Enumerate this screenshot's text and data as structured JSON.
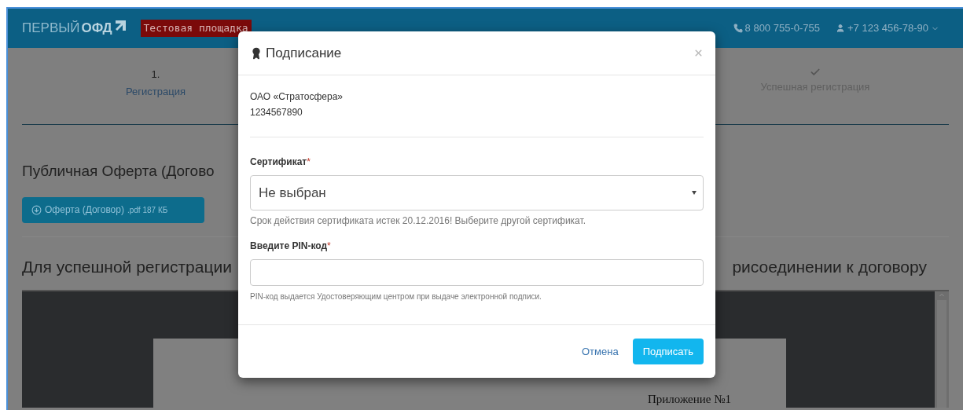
{
  "header": {
    "logo": {
      "light": "ПЕРВЫЙ",
      "bold": "ОФД"
    },
    "badge": "Тестовая площадка",
    "phone": "8 800 755-0-755",
    "user": "+7 123 456-78-90"
  },
  "steps": [
    {
      "kind": "numbered",
      "number": "1.",
      "label": "Регистрация",
      "selected": true
    },
    {
      "kind": "check",
      "label": "Успешная регистрация",
      "selected": false
    }
  ],
  "offer": {
    "heading": "Публичная Оферта (Догово",
    "button": {
      "label": "Оферта (Договор)",
      "meta": ".pdf 187 КБ"
    }
  },
  "registration": {
    "heading_left": "Для успешной регистрации",
    "heading_right": "рисоединении к договору"
  },
  "document": {
    "page_text": "Приложение №1"
  },
  "modal": {
    "title": "Подписание",
    "organization": {
      "name": "ОАО «Стратосфера»",
      "inn": "1234567890"
    },
    "fields": [
      {
        "kind": "select",
        "label": "Сертификат",
        "required": true,
        "required_mark": "*",
        "value": "Не выбран",
        "help": "Срок действия сертификата истек 20.12.2016! Выберите другой сертификат."
      },
      {
        "kind": "input",
        "label": "Введите PIN-код",
        "required": true,
        "required_mark": "*",
        "help": "PIN-код выдается Удостоверяющим центром при выдаче электронной подписи."
      }
    ],
    "cancel": "Отмена",
    "submit": "Подписать"
  }
}
